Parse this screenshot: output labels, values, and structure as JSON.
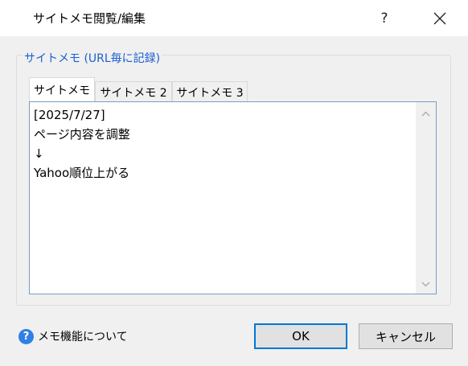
{
  "window": {
    "title": "サイトメモ閲覧/編集",
    "help_label": "?",
    "close_icon": "close-icon"
  },
  "group": {
    "label": "サイトメモ (URL毎に記録)"
  },
  "tabs": [
    {
      "label": "サイトメモ",
      "selected": true
    },
    {
      "label": "サイトメモ 2",
      "selected": false
    },
    {
      "label": "サイトメモ 3",
      "selected": false
    }
  ],
  "memo": {
    "text": "[2025/7/27]\nページ内容を調整\n↓\nYahoo順位上がる"
  },
  "footer": {
    "help_link_label": "メモ機能について",
    "help_icon_glyph": "?",
    "ok_label": "OK",
    "cancel_label": "キャンセル"
  },
  "colors": {
    "accent": "#0078d7",
    "legend_text": "#1a5fd0",
    "help_icon": "#2f7fe6"
  }
}
